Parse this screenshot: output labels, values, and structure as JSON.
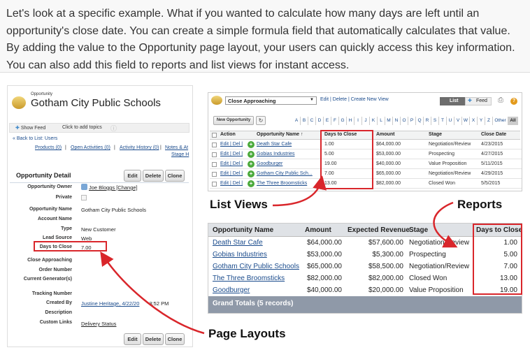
{
  "intro": {
    "text": "Let's look at a specific example. What if you wanted to calculate how many days are left until an opportunity's close date. You can create a simple formula field that automatically calculates that value. By adding the value to the Opportunity page layout, your users can quickly access this key information. You can also add this field to reports and list views for instant access."
  },
  "record": {
    "object_label": "Opportunity",
    "title": "Gotham City Public Schools",
    "show_feed": "Show Feed",
    "add_topics": "Click to add topics",
    "back_link": "« Back to List: Users",
    "related": [
      "Products (0)",
      "Open Activities (0)",
      "Activity History (0)",
      "Notes & At"
    ],
    "stage_h": "Stage H",
    "section_title": "Opportunity Detail",
    "edit": "Edit",
    "delete": "Delete",
    "clone": "Clone",
    "fields": [
      {
        "label": "Opportunity Owner",
        "value": "Joe Bloggs [Change]"
      },
      {
        "label": "Private",
        "value": ""
      },
      {
        "label": "Opportunity Name",
        "value": "Gotham City Public Schools"
      },
      {
        "label": "Account Name",
        "value": ""
      },
      {
        "label": "Type",
        "value": "New Customer"
      },
      {
        "label": "Lead Source",
        "value": "Web"
      },
      {
        "label": "Days to Close",
        "value": "7.00"
      },
      {
        "label": "Close Approaching",
        "value": ""
      },
      {
        "label": "Order Number",
        "value": ""
      },
      {
        "label": "Current Generator(s)",
        "value": ""
      },
      {
        "label": "Tracking Number",
        "value": ""
      },
      {
        "label": "Created By",
        "value": "Justine Heritage, 4/22/20",
        "value2": "3:52 PM"
      },
      {
        "label": "Description",
        "value": ""
      },
      {
        "label": "Custom Links",
        "value": "Delivery Status"
      }
    ]
  },
  "listview": {
    "selected_view": "Close Approaching",
    "links": "Edit | Delete | Create New View",
    "list_btn": "List",
    "feed_btn": "Feed",
    "new_btn": "New Opportunity",
    "alphabet": [
      "A",
      "B",
      "C",
      "D",
      "E",
      "F",
      "G",
      "H",
      "I",
      "J",
      "K",
      "L",
      "M",
      "N",
      "O",
      "P",
      "Q",
      "R",
      "S",
      "T",
      "U",
      "V",
      "W",
      "X",
      "Y",
      "Z",
      "Other",
      "All"
    ],
    "columns": [
      "Action",
      "Opportunity Name ↑",
      "Days to Close",
      "Amount",
      "Stage",
      "Close Date"
    ],
    "action_text": "Edit | Del |",
    "rows": [
      {
        "name": "Death Star Cafe",
        "days": "1.00",
        "amount": "$64,000.00",
        "stage": "Negotiation/Review",
        "date": "4/23/2015"
      },
      {
        "name": "Gobias Industries",
        "days": "5.00",
        "amount": "$53,000.00",
        "stage": "Prospecting",
        "date": "4/27/2015"
      },
      {
        "name": "Goodburger",
        "days": "19.00",
        "amount": "$40,000.00",
        "stage": "Value Proposition",
        "date": "5/11/2015"
      },
      {
        "name": "Gotham City Public Sch...",
        "days": "7.00",
        "amount": "$65,000.00",
        "stage": "Negotiation/Review",
        "date": "4/29/2015"
      },
      {
        "name": "The Three Broomsticks",
        "days": "13.00",
        "amount": "$82,000.00",
        "stage": "Closed Won",
        "date": "5/5/2015"
      }
    ]
  },
  "labels": {
    "list_views": "List Views",
    "reports": "Reports",
    "page_layouts": "Page Layouts"
  },
  "report": {
    "columns": [
      "Opportunity Name",
      "Amount",
      "Expected Revenue",
      "Stage",
      "Days to Close"
    ],
    "rows": [
      {
        "name": "Death Star Cafe",
        "amount": "$64,000.00",
        "revenue": "$57,600.00",
        "stage": "Negotiation/Review",
        "days": "1.00"
      },
      {
        "name": "Gobias Industries",
        "amount": "$53,000.00",
        "revenue": "$5,300.00",
        "stage": "Prospecting",
        "days": "5.00"
      },
      {
        "name": "Gotham City Public Schools",
        "amount": "$65,000.00",
        "revenue": "$58,500.00",
        "stage": "Negotiation/Review",
        "days": "7.00"
      },
      {
        "name": "The Three Broomsticks",
        "amount": "$82,000.00",
        "revenue": "$82,000.00",
        "stage": "Closed Won",
        "days": "13.00"
      },
      {
        "name": "Goodburger",
        "amount": "$40,000.00",
        "revenue": "$20,000.00",
        "stage": "Value Proposition",
        "days": "19.00"
      }
    ],
    "grand_total": "Grand Totals (5 records)"
  },
  "colors": {
    "accent_red": "#d9262b",
    "link_blue": "#1a4b8c",
    "report_header": "#8f99a8"
  }
}
